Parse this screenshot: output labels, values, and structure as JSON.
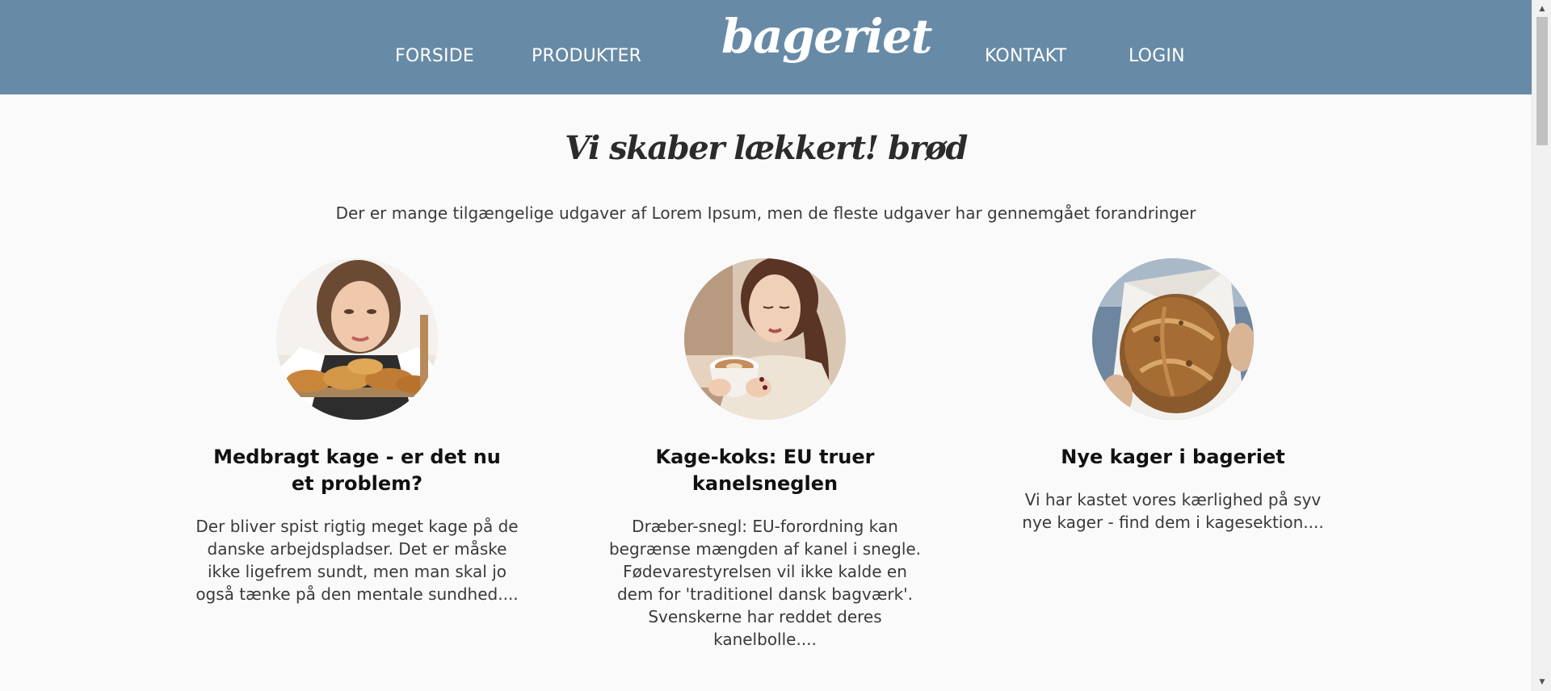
{
  "nav": {
    "links": [
      "FORSIDE",
      "PRODUKTER",
      "KONTAKT",
      "LOGIN"
    ],
    "logo": "bageriet"
  },
  "hero": {
    "title": "Vi skaber lækkert! brød",
    "subtitle": "Der er mange tilgængelige udgaver af Lorem Ipsum, men de fleste udgaver har gennemgået forandringer"
  },
  "cards": [
    {
      "title": "Medbragt kage - er det nu et problem?",
      "text": "Der bliver spist rigtig meget kage på de danske arbejdspladser. Det er måske ikke ligefrem sundt, men man skal jo også tænke på den mentale sundhed...."
    },
    {
      "title": "Kage-koks: EU truer kanelsneglen",
      "text": "Dræber-snegl: EU-forordning kan begrænse mængden af kanel i snegle. Fødevarestyrelsen vil ikke kalde en dem for 'traditionel dansk bagværk'. Svenskerne har reddet deres kanelbolle...."
    },
    {
      "title": "Nye kager i bageriet",
      "text": "Vi har kastet vores kærlighed på syv nye kager - find dem i kagesektion...."
    }
  ],
  "colors": {
    "header": "#678aa6",
    "background": "#fafafa"
  }
}
